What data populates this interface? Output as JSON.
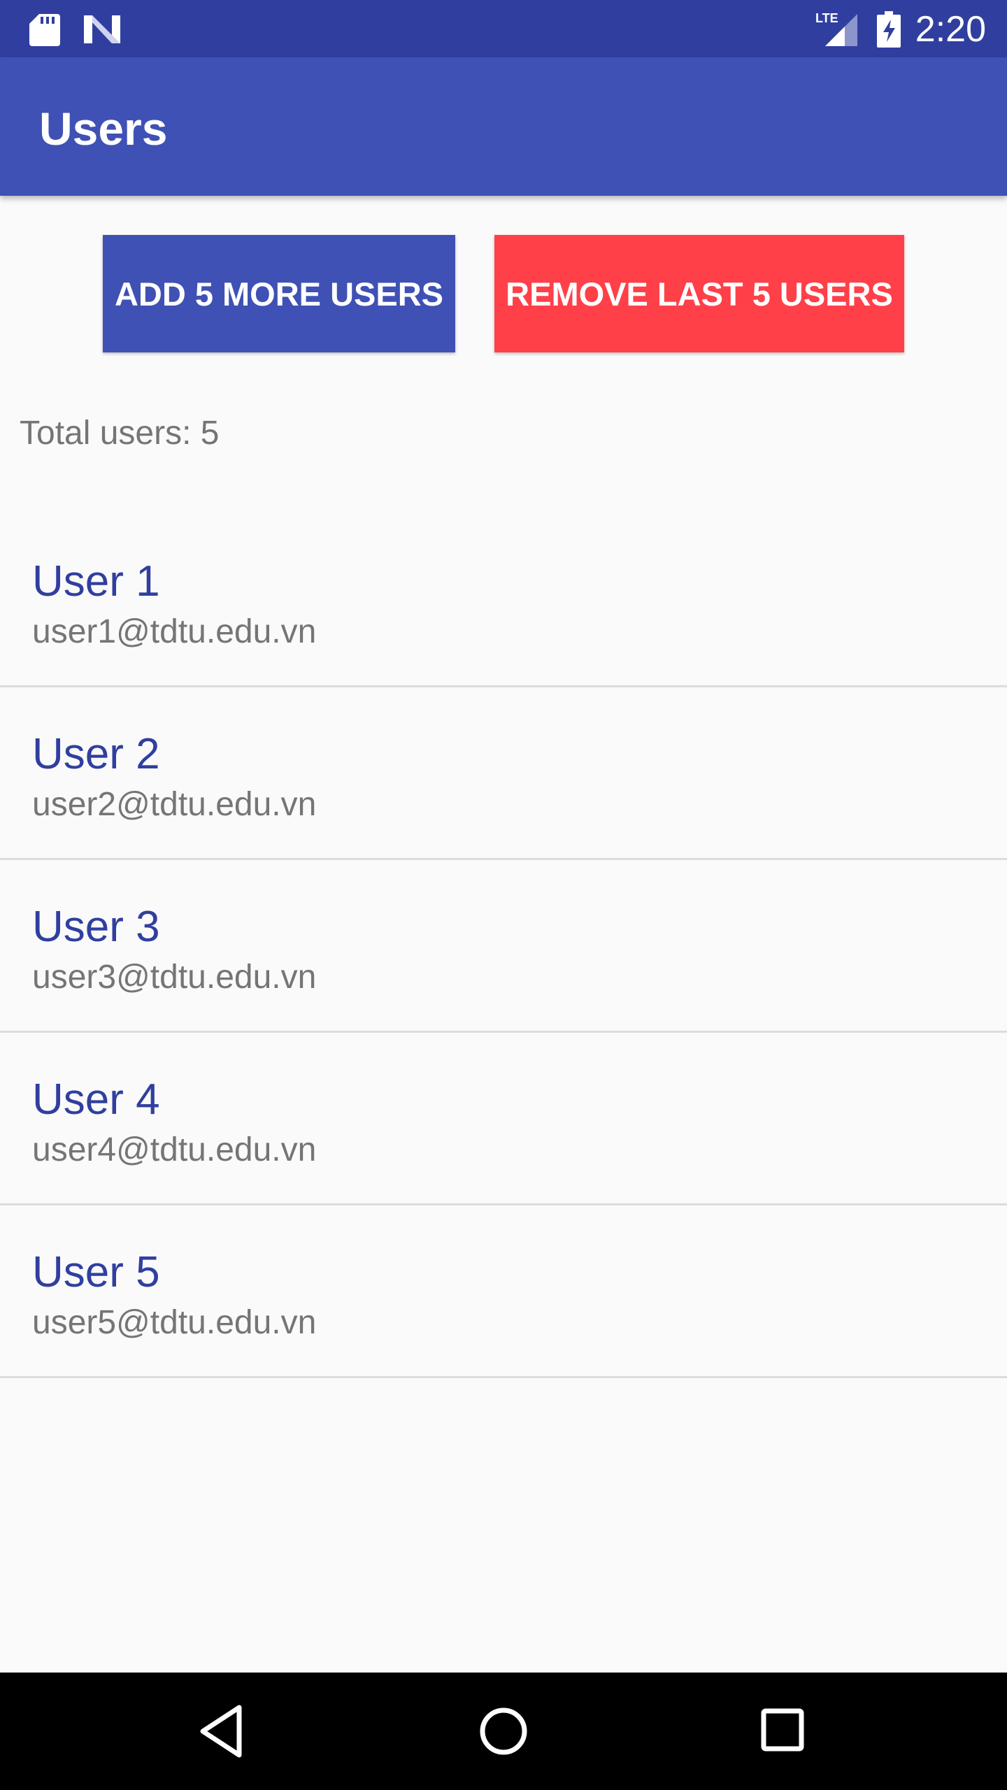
{
  "status_bar": {
    "time": "2:20",
    "network": "LTE",
    "icons": [
      "sd-card-icon",
      "n-logo-icon",
      "lte-signal-icon",
      "battery-charging-icon"
    ]
  },
  "app_bar": {
    "title": "Users"
  },
  "actions": {
    "add_label": "ADD 5 MORE USERS",
    "remove_label": "REMOVE LAST 5 USERS"
  },
  "total_text": "Total users: 5",
  "users": [
    {
      "name": "User 1",
      "email": "user1@tdtu.edu.vn"
    },
    {
      "name": "User 2",
      "email": "user2@tdtu.edu.vn"
    },
    {
      "name": "User 3",
      "email": "user3@tdtu.edu.vn"
    },
    {
      "name": "User 4",
      "email": "user4@tdtu.edu.vn"
    },
    {
      "name": "User 5",
      "email": "user5@tdtu.edu.vn"
    }
  ],
  "colors": {
    "status_bar": "#303f9f",
    "primary": "#3f51b5",
    "danger": "#ff4049",
    "name_text": "#303f9f",
    "secondary_text": "#757575"
  },
  "nav_bar": {
    "icons": [
      "back-icon",
      "home-icon",
      "recents-icon"
    ]
  }
}
